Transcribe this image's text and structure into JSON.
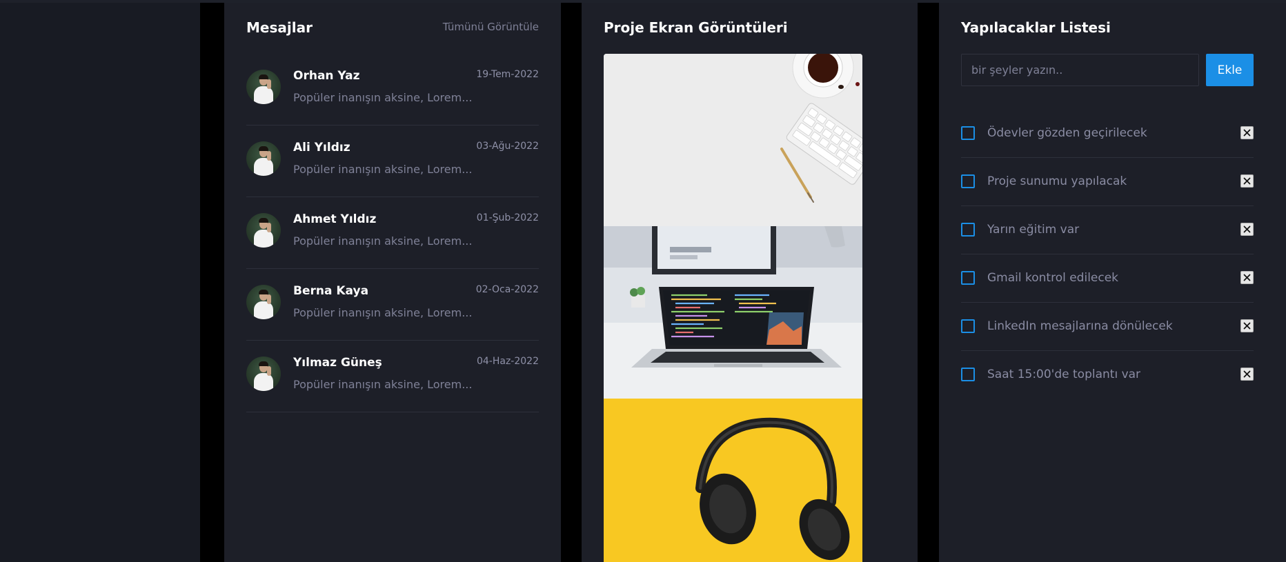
{
  "messages": {
    "title": "Mesajlar",
    "view_all": "Tümünü Görüntüle",
    "items": [
      {
        "name": "Orhan Yaz",
        "date": "19-Tem-2022",
        "preview": "Popüler inanışın aksine, Lorem..."
      },
      {
        "name": "Ali Yıldız",
        "date": "03-Ağu-2022",
        "preview": "Popüler inanışın aksine, Lorem..."
      },
      {
        "name": "Ahmet Yıldız",
        "date": "01-Şub-2022",
        "preview": "Popüler inanışın aksine, Lorem..."
      },
      {
        "name": "Berna Kaya",
        "date": "02-Oca-2022",
        "preview": "Popüler inanışın aksine, Lorem..."
      },
      {
        "name": "Yılmaz Güneş",
        "date": "04-Haz-2022",
        "preview": "Popüler inanışın aksine, Lorem..."
      }
    ]
  },
  "screenshots": {
    "title": "Proje Ekran Görüntüleri",
    "images": [
      {
        "subject": "desk-keyboard-coffee"
      },
      {
        "subject": "laptop-code"
      },
      {
        "subject": "headphones-yellow"
      }
    ]
  },
  "todo": {
    "title": "Yapılacaklar Listesi",
    "input_placeholder": "bir şeyler yazın..",
    "add_label": "Ekle",
    "items": [
      {
        "text": "Ödevler gözden geçirilecek"
      },
      {
        "text": "Proje sunumu yapılacak"
      },
      {
        "text": "Yarın eğitim var"
      },
      {
        "text": "Gmail kontrol edilecek"
      },
      {
        "text": "LinkedIn mesajlarına dönülecek"
      },
      {
        "text": "Saat 15:00'de toplantı var"
      }
    ]
  },
  "colors": {
    "background": "#181b23",
    "panel": "#1d1f28",
    "accent": "#1b8fe6",
    "muted_text": "#7f8197"
  }
}
